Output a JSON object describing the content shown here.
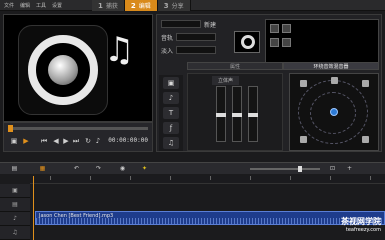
{
  "menu": {
    "items": [
      "文件",
      "编辑",
      "工具",
      "设置"
    ]
  },
  "steps": [
    {
      "num": "1",
      "label": "捕获"
    },
    {
      "num": "2",
      "label": "编辑",
      "active": true
    },
    {
      "num": "3",
      "label": "分享"
    }
  ],
  "transport": {
    "timecode": "00:00:00:00"
  },
  "options": {
    "new_label": "新建",
    "row2_label": "音轨",
    "row3_label": "淡入",
    "tabs": [
      "属性",
      "环绕音效混音器"
    ],
    "stereo_label": "立体声"
  },
  "timeline": {
    "clip_label": "Jason Chen [Best Friend].mp3"
  },
  "watermark": {
    "line1": "茶视网学院",
    "line2": "teafreezy.com"
  },
  "colors": {
    "accent": "#d98a1a",
    "clip": "#1e3c8c",
    "surround_center": "#2d7bd6"
  }
}
